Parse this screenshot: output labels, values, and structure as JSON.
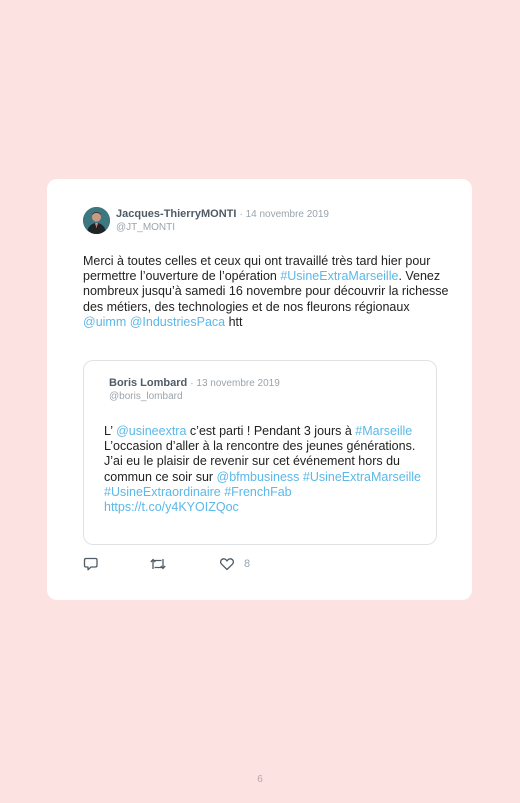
{
  "tweet": {
    "author_name": "Jacques-ThierryMONTI",
    "date": "· 14 novembre 2019",
    "handle": "@JT_MONTI",
    "text": [
      {
        "t": "Merci à toutes celles et ceux qui ont travaillé très tard hier pour permettre l’ouverture de l’opération ",
        "link": false
      },
      {
        "t": "#UsineExtraMarseille",
        "link": true
      },
      {
        "t": ". Venez nombreux jusqu’à samedi 16 novembre pour découvrir la richesse des métiers, des technologies et de nos fleurons régionaux ",
        "link": false
      },
      {
        "t": "@uimm",
        "link": true
      },
      {
        "t": " ",
        "link": false
      },
      {
        "t": "@IndustriesPaca",
        "link": true
      },
      {
        "t": " htt",
        "link": false
      }
    ],
    "like_count": "8"
  },
  "quoted": {
    "author_name": "Boris Lombard",
    "date": "· 13 novembre 2019",
    "handle": "@boris_lombard",
    "text": [
      {
        "t": "L’ ",
        "link": false
      },
      {
        "t": "@usineextra",
        "link": true
      },
      {
        "t": " c’est parti ! Pendant 3 jours à ",
        "link": false
      },
      {
        "t": "#Marseille",
        "link": true
      },
      {
        "t": " L’occasion d’aller à la rencontre des jeunes générations. J’ai eu le plaisir de revenir sur cet événement hors du commun ce soir sur ",
        "link": false
      },
      {
        "t": "@bfmbusiness",
        "link": true
      },
      {
        "t": " ",
        "link": false
      },
      {
        "t": "#UsineExtraMarseille",
        "link": true
      },
      {
        "t": " ",
        "link": false
      },
      {
        "t": "#UsineExtraordinaire",
        "link": true
      },
      {
        "t": " ",
        "link": false
      },
      {
        "t": "#FrenchFab",
        "link": true
      },
      {
        "t": " ",
        "link": false
      },
      {
        "t": "https://t.co/y4KYOIZQoc",
        "link": true
      }
    ]
  },
  "icons": {
    "reply": "reply-icon",
    "retweet": "retweet-icon",
    "like": "heart-icon"
  },
  "colors": {
    "background": "#fde2e2",
    "link": "#5bb8e8",
    "meta": "#9aa4ad"
  },
  "page_number": "6"
}
